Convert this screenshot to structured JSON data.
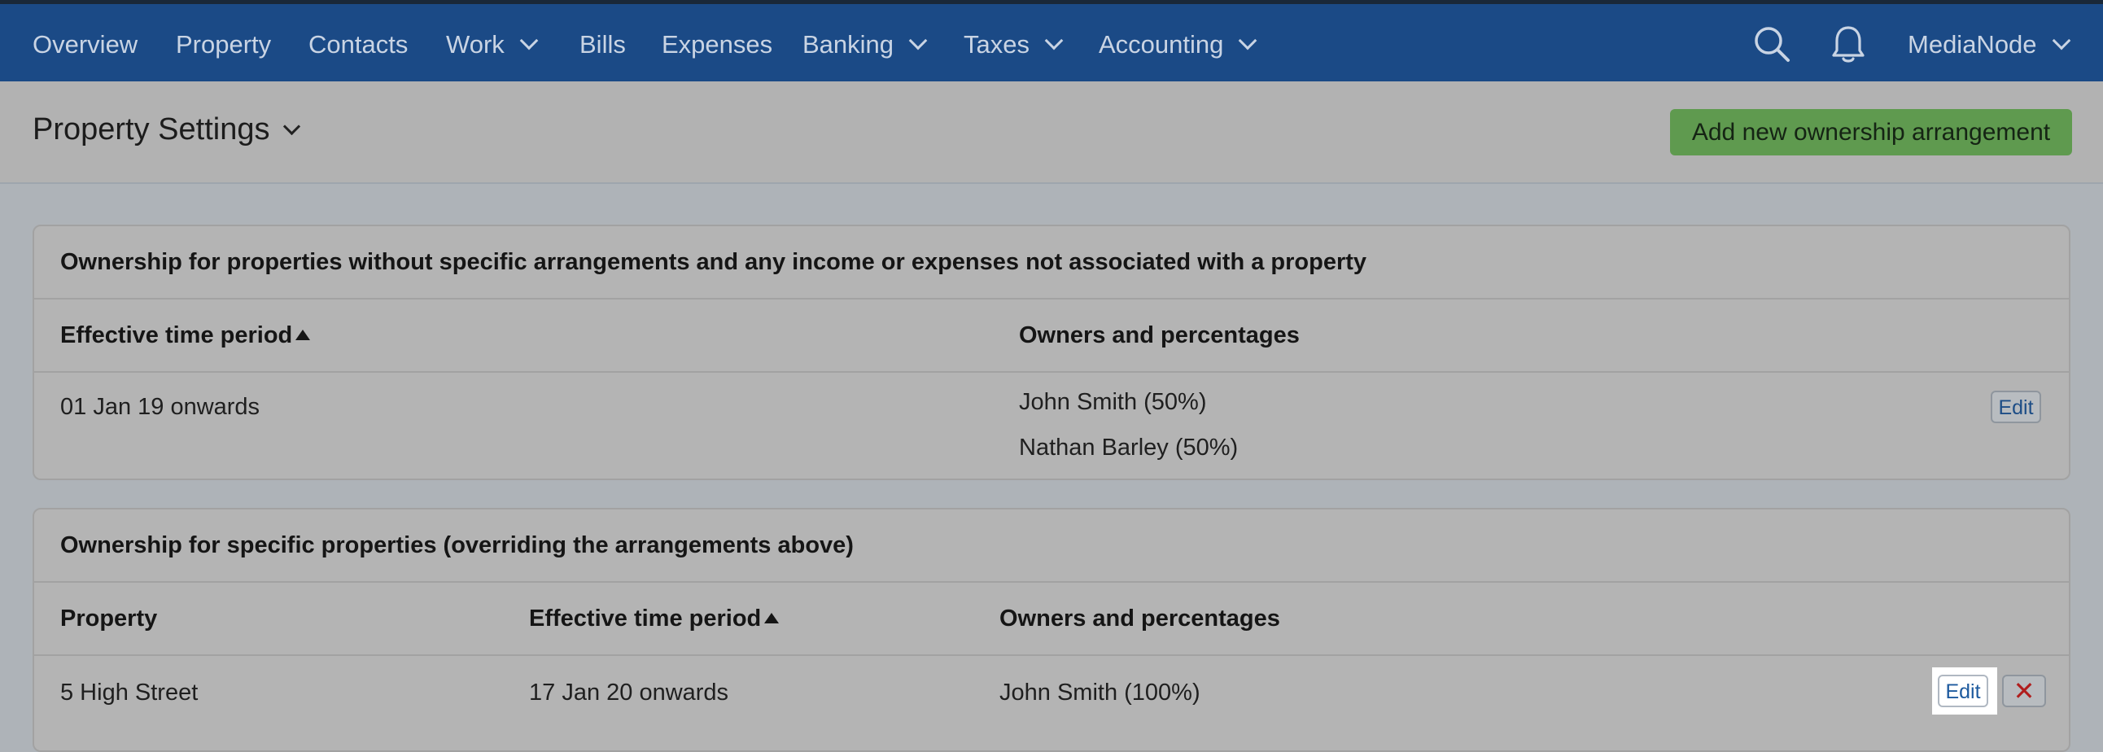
{
  "nav": {
    "items": [
      {
        "label": "Overview",
        "dropdown": false
      },
      {
        "label": "Property",
        "dropdown": false
      },
      {
        "label": "Contacts",
        "dropdown": false
      },
      {
        "label": "Work",
        "dropdown": true
      },
      {
        "label": "Bills",
        "dropdown": false
      },
      {
        "label": "Expenses",
        "dropdown": false
      },
      {
        "label": "Banking",
        "dropdown": true
      },
      {
        "label": "Taxes",
        "dropdown": true
      },
      {
        "label": "Accounting",
        "dropdown": true
      }
    ],
    "search_icon": "search-icon",
    "notifications_icon": "bell-icon",
    "account_label": "MediaNode"
  },
  "subheader": {
    "title": "Property Settings",
    "add_button_label": "Add new ownership arrangement"
  },
  "general_section": {
    "heading": "Ownership for properties without specific arrangements and any income or expenses not associated with a property",
    "col_period": "Effective time period",
    "col_owners": "Owners and percentages",
    "rows": [
      {
        "period": "01 Jan 19 onwards",
        "owners": [
          "John Smith (50%)",
          "Nathan Barley (50%)"
        ],
        "edit_label": "Edit"
      }
    ]
  },
  "specific_section": {
    "heading": "Ownership for specific properties (overriding the arrangements above)",
    "col_property": "Property",
    "col_period": "Effective time period",
    "col_owners": "Owners and percentages",
    "rows": [
      {
        "property": "5 High Street",
        "period": "17 Jan 20 onwards",
        "owners": "John Smith (100%)",
        "edit_label": "Edit",
        "delete_symbol": "✕"
      }
    ]
  },
  "colors": {
    "nav_bg": "#1b4a86",
    "add_button": "#5f9a4f",
    "delete_x": "#b01e1e",
    "link_blue": "#1d5a9e"
  }
}
